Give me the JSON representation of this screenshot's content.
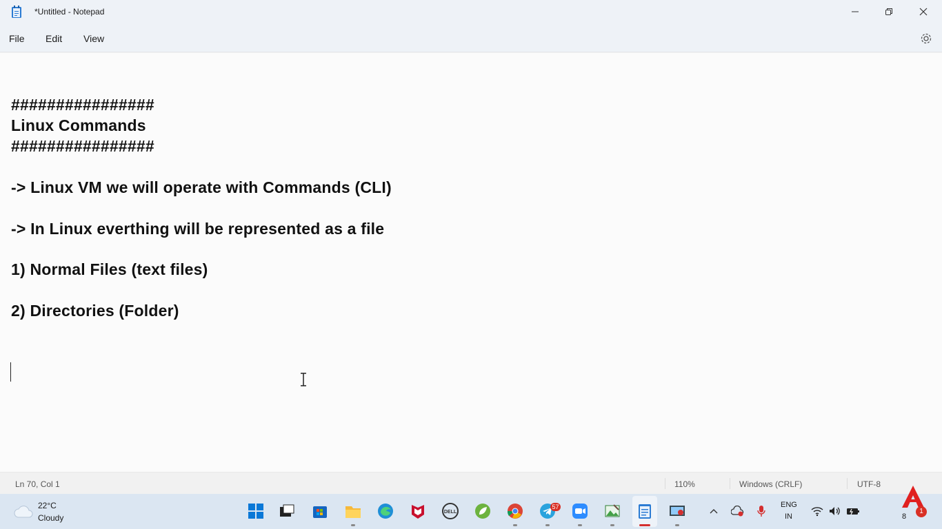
{
  "window": {
    "title": "*Untitled - Notepad"
  },
  "menu": {
    "file": "File",
    "edit": "Edit",
    "view": "View"
  },
  "editor": {
    "lines": [
      "################",
      "Linux Commands",
      "################",
      "-> Linux VM we will operate with Commands (CLI)",
      "-> In Linux everthing will be represented as a file",
      "1) Normal Files (text files)",
      "2) Directories (Folder)"
    ]
  },
  "status": {
    "position": "Ln 70, Col 1",
    "zoom": "110%",
    "line_ending": "Windows (CRLF)",
    "encoding": "UTF-8"
  },
  "taskbar": {
    "weather_temp": "22°C",
    "weather_desc": "Cloudy",
    "telegram_badge": "57",
    "lang_top": "ENG",
    "lang_bottom": "IN",
    "clock_partial": "8",
    "notification_badge": "1"
  },
  "colors": {
    "accent": "#0067c0",
    "red": "#d93025"
  }
}
